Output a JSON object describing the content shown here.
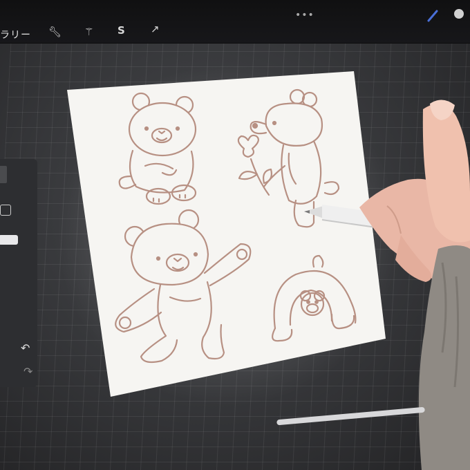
{
  "toolbar": {
    "gallery_label": "ラリー",
    "more_label": "•••",
    "icons": [
      "wrench-icon",
      "magic-wand-icon",
      "selection-s-icon",
      "transform-arrow-icon"
    ]
  },
  "sidebar": {
    "undo_icon": "undo-icon",
    "redo_icon": "redo-icon"
  },
  "colors": {
    "canvas": "#f6f5f2",
    "line_art": "#b79083",
    "ui_dark": "#151517",
    "sweater": "#8f8a84",
    "pencil": "#eeeeee"
  }
}
